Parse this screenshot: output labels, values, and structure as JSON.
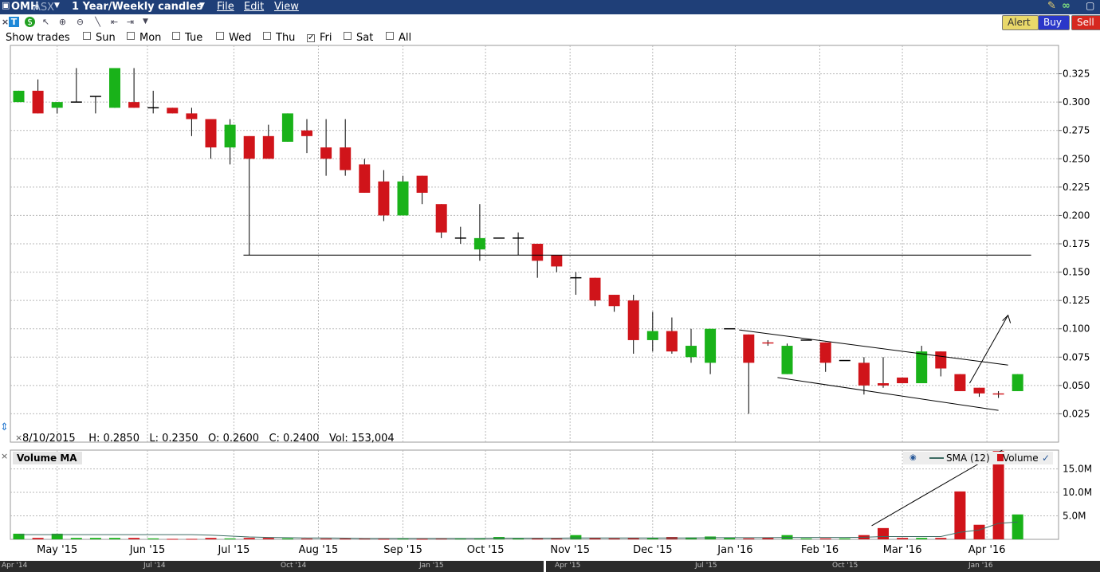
{
  "header": {
    "symbol": "OMH",
    "exchange": "ASX",
    "period": "1 Year/Weekly candles",
    "menu": [
      "File",
      "Edit",
      "View"
    ]
  },
  "trade_buttons": {
    "alert": "Alert",
    "buy": "Buy",
    "sell": "Sell"
  },
  "show_trades": {
    "label": "Show trades",
    "days": [
      {
        "label": "Sun",
        "checked": false
      },
      {
        "label": "Mon",
        "checked": false
      },
      {
        "label": "Tue",
        "checked": false
      },
      {
        "label": "Wed",
        "checked": false
      },
      {
        "label": "Thu",
        "checked": false
      },
      {
        "label": "Fri",
        "checked": true
      },
      {
        "label": "Sat",
        "checked": false
      },
      {
        "label": "All",
        "checked": false
      }
    ]
  },
  "ohlc": {
    "date": "8/10/2015",
    "high": "H: 0.2850",
    "low": "L: 0.2350",
    "open": "O: 0.2600",
    "close": "C: 0.2400",
    "volume": "Vol: 153,004"
  },
  "volume_panel": {
    "title": "Volume MA",
    "legend_sma": "SMA (12)",
    "legend_volume": "Volume"
  },
  "bottom_axis": [
    "Apr '14",
    "Jul '14",
    "Oct '14",
    "Jan '15",
    "Apr '15",
    "Jul '15",
    "Oct '15",
    "Jan '16"
  ],
  "colors": {
    "up": "#19b219",
    "down": "#d0141a",
    "grid": "#b9b9b9",
    "titlebar": "#1f3f78"
  },
  "chart_data": [
    {
      "type": "candlestick",
      "x_ticks": [
        "May '15",
        "Jun '15",
        "Jul '15",
        "Aug '15",
        "Sep '15",
        "Oct '15",
        "Nov '15",
        "Dec '15",
        "Jan '16",
        "Feb '16",
        "Mar '16",
        "Apr '16"
      ],
      "y_ticks": [
        0.025,
        0.05,
        0.075,
        0.1,
        0.125,
        0.15,
        0.175,
        0.2,
        0.225,
        0.25,
        0.275,
        0.3,
        0.325
      ],
      "ylim": [
        0.0,
        0.35
      ],
      "grid": true,
      "candles": [
        {
          "o": 0.3,
          "h": 0.31,
          "l": 0.3,
          "c": 0.31
        },
        {
          "o": 0.31,
          "h": 0.32,
          "l": 0.29,
          "c": 0.29
        },
        {
          "o": 0.295,
          "h": 0.3,
          "l": 0.29,
          "c": 0.3
        },
        {
          "o": 0.3,
          "h": 0.33,
          "l": 0.3,
          "c": 0.3
        },
        {
          "o": 0.305,
          "h": 0.305,
          "l": 0.29,
          "c": 0.305
        },
        {
          "o": 0.295,
          "h": 0.33,
          "l": 0.295,
          "c": 0.33
        },
        {
          "o": 0.3,
          "h": 0.33,
          "l": 0.295,
          "c": 0.295
        },
        {
          "o": 0.295,
          "h": 0.31,
          "l": 0.29,
          "c": 0.295
        },
        {
          "o": 0.295,
          "h": 0.295,
          "l": 0.29,
          "c": 0.29
        },
        {
          "o": 0.29,
          "h": 0.295,
          "l": 0.27,
          "c": 0.285
        },
        {
          "o": 0.285,
          "h": 0.285,
          "l": 0.25,
          "c": 0.26
        },
        {
          "o": 0.26,
          "h": 0.285,
          "l": 0.245,
          "c": 0.28
        },
        {
          "o": 0.27,
          "h": 0.27,
          "l": 0.165,
          "c": 0.25
        },
        {
          "o": 0.27,
          "h": 0.28,
          "l": 0.25,
          "c": 0.25
        },
        {
          "o": 0.265,
          "h": 0.29,
          "l": 0.265,
          "c": 0.29
        },
        {
          "o": 0.275,
          "h": 0.285,
          "l": 0.255,
          "c": 0.27
        },
        {
          "o": 0.26,
          "h": 0.285,
          "l": 0.235,
          "c": 0.25
        },
        {
          "o": 0.26,
          "h": 0.285,
          "l": 0.235,
          "c": 0.24
        },
        {
          "o": 0.245,
          "h": 0.25,
          "l": 0.22,
          "c": 0.22
        },
        {
          "o": 0.23,
          "h": 0.24,
          "l": 0.195,
          "c": 0.2
        },
        {
          "o": 0.2,
          "h": 0.235,
          "l": 0.2,
          "c": 0.23
        },
        {
          "o": 0.235,
          "h": 0.235,
          "l": 0.21,
          "c": 0.22
        },
        {
          "o": 0.21,
          "h": 0.21,
          "l": 0.18,
          "c": 0.185
        },
        {
          "o": 0.18,
          "h": 0.19,
          "l": 0.175,
          "c": 0.18
        },
        {
          "o": 0.17,
          "h": 0.21,
          "l": 0.16,
          "c": 0.18
        },
        {
          "o": 0.18,
          "h": 0.18,
          "l": 0.18,
          "c": 0.18
        },
        {
          "o": 0.18,
          "h": 0.185,
          "l": 0.165,
          "c": 0.18
        },
        {
          "o": 0.175,
          "h": 0.175,
          "l": 0.145,
          "c": 0.16
        },
        {
          "o": 0.165,
          "h": 0.165,
          "l": 0.15,
          "c": 0.155
        },
        {
          "o": 0.145,
          "h": 0.15,
          "l": 0.13,
          "c": 0.145
        },
        {
          "o": 0.145,
          "h": 0.145,
          "l": 0.12,
          "c": 0.125
        },
        {
          "o": 0.13,
          "h": 0.13,
          "l": 0.115,
          "c": 0.12
        },
        {
          "o": 0.125,
          "h": 0.13,
          "l": 0.078,
          "c": 0.09
        },
        {
          "o": 0.09,
          "h": 0.115,
          "l": 0.08,
          "c": 0.098
        },
        {
          "o": 0.098,
          "h": 0.11,
          "l": 0.078,
          "c": 0.08
        },
        {
          "o": 0.075,
          "h": 0.1,
          "l": 0.07,
          "c": 0.085
        },
        {
          "o": 0.07,
          "h": 0.1,
          "l": 0.06,
          "c": 0.1
        },
        {
          "o": 0.1,
          "h": 0.1,
          "l": 0.1,
          "c": 0.1
        },
        {
          "o": 0.095,
          "h": 0.095,
          "l": 0.025,
          "c": 0.07
        },
        {
          "o": 0.088,
          "h": 0.09,
          "l": 0.085,
          "c": 0.087
        },
        {
          "o": 0.06,
          "h": 0.087,
          "l": 0.06,
          "c": 0.085
        },
        {
          "o": 0.09,
          "h": 0.09,
          "l": 0.09,
          "c": 0.09
        },
        {
          "o": 0.088,
          "h": 0.088,
          "l": 0.062,
          "c": 0.07
        },
        {
          "o": 0.072,
          "h": 0.072,
          "l": 0.072,
          "c": 0.072
        },
        {
          "o": 0.07,
          "h": 0.075,
          "l": 0.042,
          "c": 0.05
        },
        {
          "o": 0.052,
          "h": 0.075,
          "l": 0.048,
          "c": 0.05
        },
        {
          "o": 0.057,
          "h": 0.057,
          "l": 0.052,
          "c": 0.052
        },
        {
          "o": 0.052,
          "h": 0.085,
          "l": 0.052,
          "c": 0.08
        },
        {
          "o": 0.08,
          "h": 0.08,
          "l": 0.058,
          "c": 0.065
        },
        {
          "o": 0.06,
          "h": 0.06,
          "l": 0.045,
          "c": 0.045
        },
        {
          "o": 0.048,
          "h": 0.048,
          "l": 0.04,
          "c": 0.043
        },
        {
          "o": 0.043,
          "h": 0.045,
          "l": 0.039,
          "c": 0.042
        },
        {
          "o": 0.045,
          "h": 0.06,
          "l": 0.045,
          "c": 0.06
        }
      ],
      "annotations": [
        {
          "kind": "support_line",
          "y": 0.165
        },
        {
          "kind": "trendline_upper",
          "from": [
            0.099,
            37.5
          ],
          "to": [
            0.068,
            51.5
          ]
        },
        {
          "kind": "trendline_lower",
          "from": [
            0.057,
            39.5
          ],
          "to": [
            0.028,
            51
          ]
        },
        {
          "kind": "arrow",
          "from": [
            0.052,
            49.5
          ],
          "to": [
            0.112,
            51.5
          ]
        }
      ]
    },
    {
      "type": "bar",
      "title": "Volume MA",
      "y_ticks": [
        5000000,
        10000000,
        15000000
      ],
      "y_tick_labels": [
        "5.0M",
        "10.0M",
        "15.0M"
      ],
      "ylim": [
        0,
        19000000
      ],
      "series": [
        {
          "name": "Volume",
          "values": [
            1200000,
            300000,
            1200000,
            300000,
            300000,
            300000,
            300000,
            200000,
            100000,
            100000,
            300000,
            200000,
            300000,
            300000,
            200000,
            150000,
            150000,
            153004,
            150000,
            100000,
            150000,
            100000,
            150000,
            150000,
            150000,
            500000,
            150000,
            150000,
            150000,
            900000,
            300000,
            200000,
            300000,
            300000,
            500000,
            400000,
            600000,
            300000,
            200000,
            300000,
            900000,
            200000,
            200000,
            200000,
            900000,
            2400000,
            300000,
            300000,
            300000,
            10200000,
            3100000,
            18800000,
            5300000
          ]
        },
        {
          "name": "SMA (12)",
          "values": [
            1000000,
            1000000,
            1000000,
            1000000,
            1000000,
            1000000,
            1000000,
            1000000,
            1000000,
            1000000,
            900000,
            700000,
            500000,
            400000,
            350000,
            300000,
            300000,
            250000,
            200000,
            200000,
            200000,
            200000,
            200000,
            200000,
            200000,
            250000,
            250000,
            250000,
            250000,
            300000,
            300000,
            300000,
            300000,
            300000,
            300000,
            300000,
            350000,
            350000,
            350000,
            350000,
            400000,
            400000,
            400000,
            400000,
            450000,
            600000,
            600000,
            600000,
            600000,
            1500000,
            2000000,
            3400000,
            3700000
          ]
        }
      ],
      "annotations": [
        {
          "kind": "trendline",
          "from": [
            2900000,
            44.4
          ],
          "to": [
            19000000,
            51.2
          ]
        }
      ]
    }
  ]
}
